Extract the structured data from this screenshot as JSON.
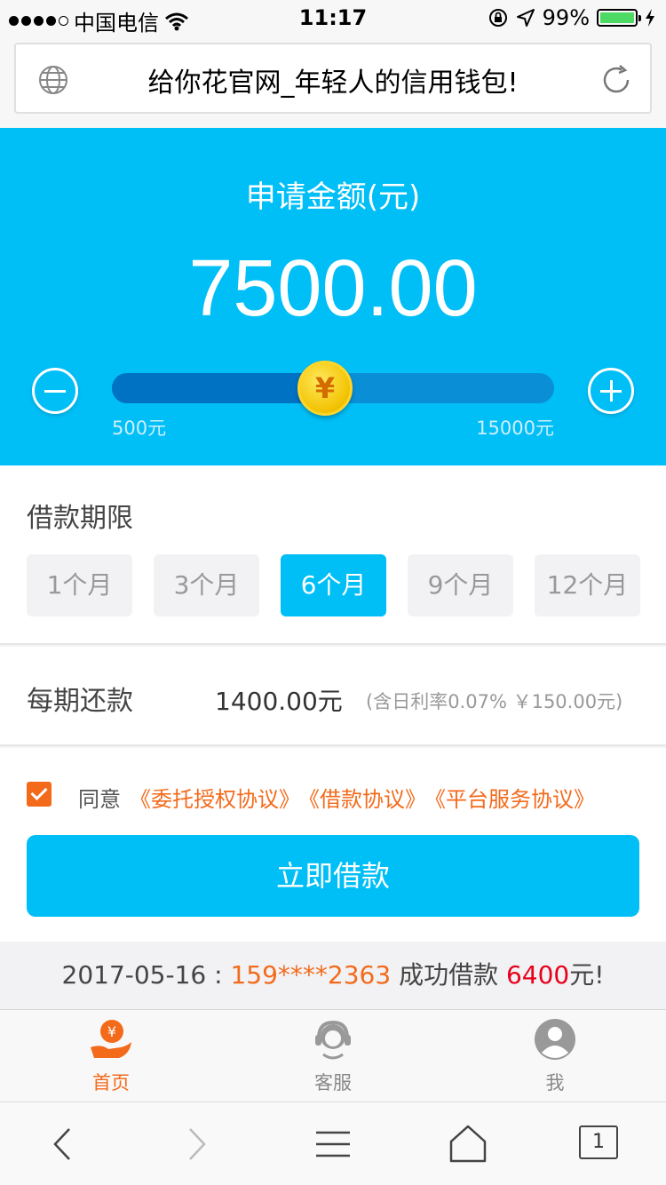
{
  "status_bar": {
    "carrier": "中国电信",
    "time": "11:17",
    "battery": "99%"
  },
  "browser": {
    "page_title": "给你花官网_年轻人的信用钱包!"
  },
  "amount": {
    "label": "申请金额(元)",
    "value": "7500.00",
    "min_label": "500元",
    "max_label": "15000元",
    "slider_value": 7500,
    "slider_min": 500,
    "slider_max": 15000,
    "knob_symbol": "¥"
  },
  "term": {
    "heading": "借款期限",
    "options": [
      "1个月",
      "3个月",
      "6个月",
      "9个月",
      "12个月"
    ],
    "selected": "6个月"
  },
  "repay": {
    "heading": "每期还款",
    "amount": "1400.00元",
    "note": "(含日利率0.07% ￥150.00元)"
  },
  "agreement": {
    "prefix": "同意",
    "links": [
      "《委托授权协议》",
      "《借款协议》",
      "《平台服务协议》"
    ],
    "checked": true
  },
  "submit_label": "立即借款",
  "ticker": {
    "date": "2017-05-16 : ",
    "phone": "159****2363",
    "middle": " 成功借款 ",
    "money": "6400",
    "suffix": "元!"
  },
  "tabs": [
    {
      "label": "首页",
      "icon": "home-yuan-icon"
    },
    {
      "label": "客服",
      "icon": "customer-service-icon"
    },
    {
      "label": "我",
      "icon": "user-icon"
    }
  ],
  "toolbar": {
    "tab_count": "1"
  },
  "colors": {
    "primary": "#00bff6",
    "accent": "#f36a1b",
    "highlight": "#e8001c"
  }
}
